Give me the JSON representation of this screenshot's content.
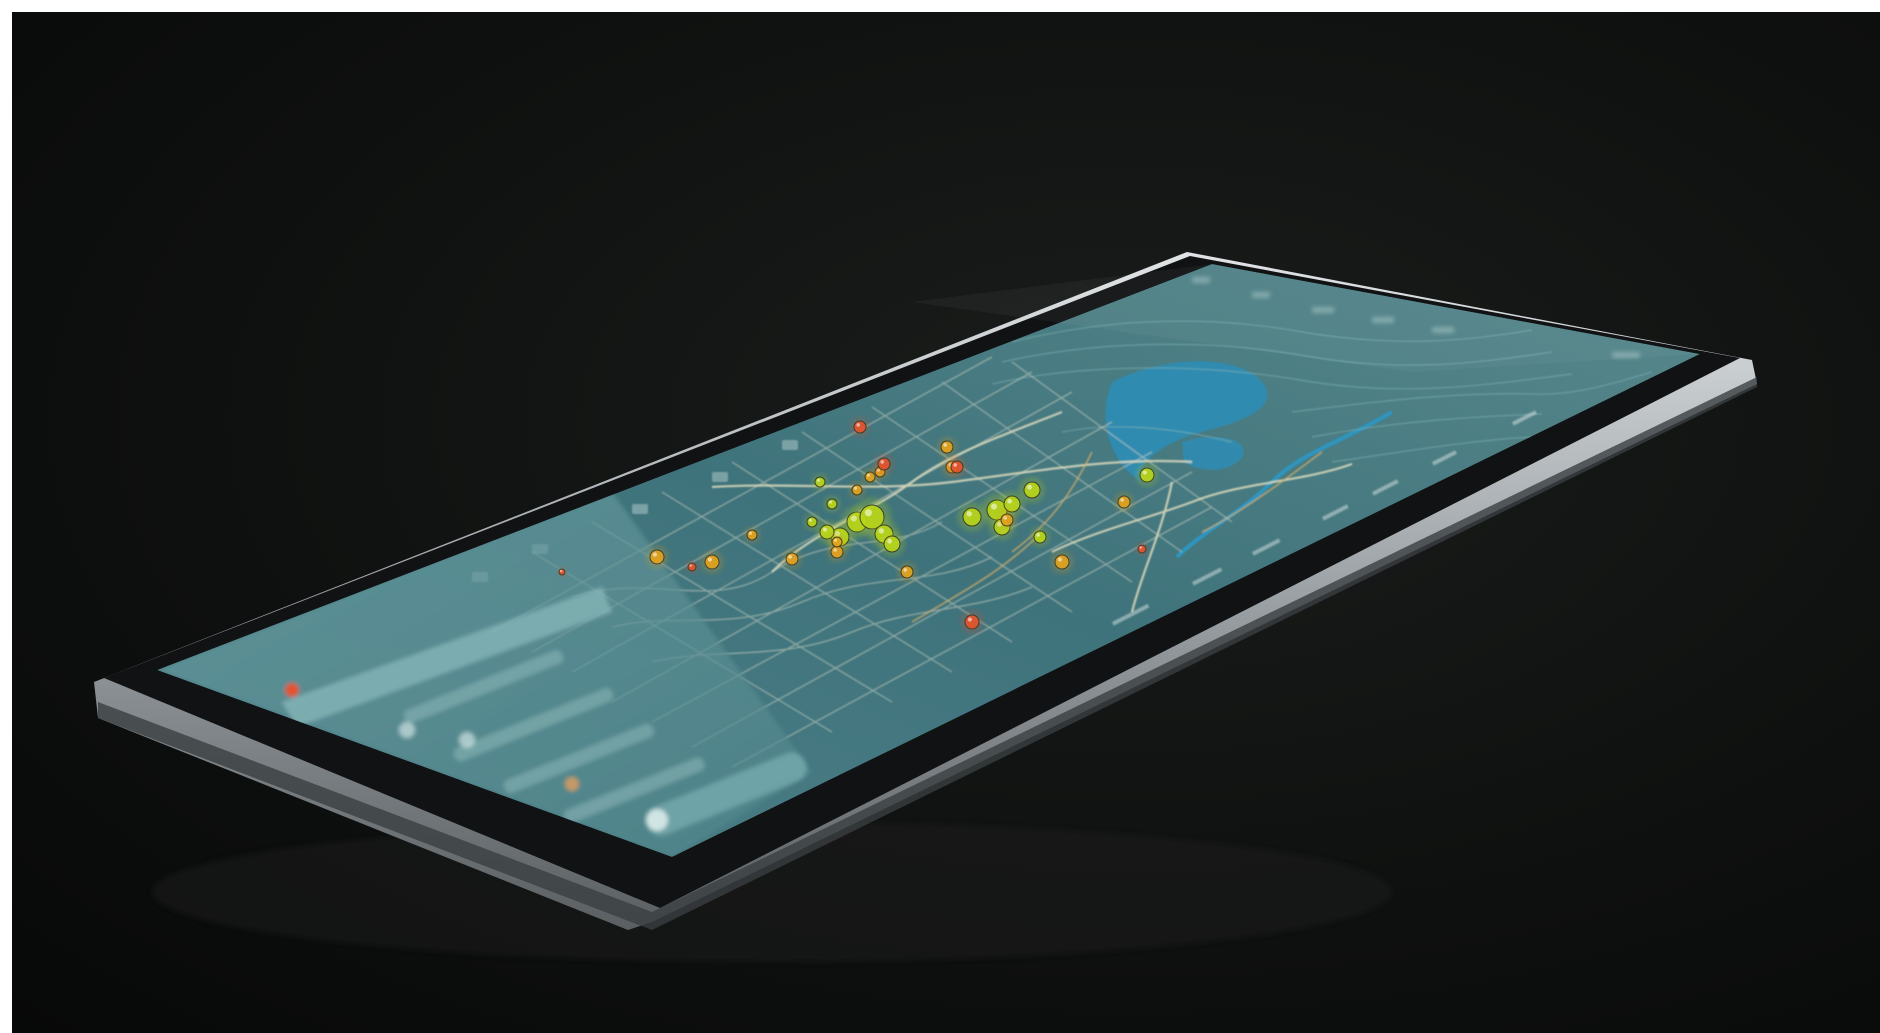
{
  "scene": {
    "description_none": "",
    "background_color": "#0c0e0d",
    "device": {
      "bezel_color": "#141618",
      "frame_color": "#b9bec2",
      "screen_color": "#4d7f86"
    }
  },
  "map": {
    "water_color": "#2f8fb3",
    "road_color": "#d7d8c4",
    "road_accent_color": "#d2b36a",
    "markers": {
      "green_color": "#b8d51a",
      "amber_color": "#e3a21e",
      "red_color": "#e5532d"
    }
  },
  "sidebar": {
    "panel_color": "#5f9297",
    "highlight_color": "#7fb0b4",
    "items_icons": [
      "status-dot-icon",
      "pin-icon",
      "layers-icon",
      "flag-icon",
      "locate-icon"
    ]
  }
}
